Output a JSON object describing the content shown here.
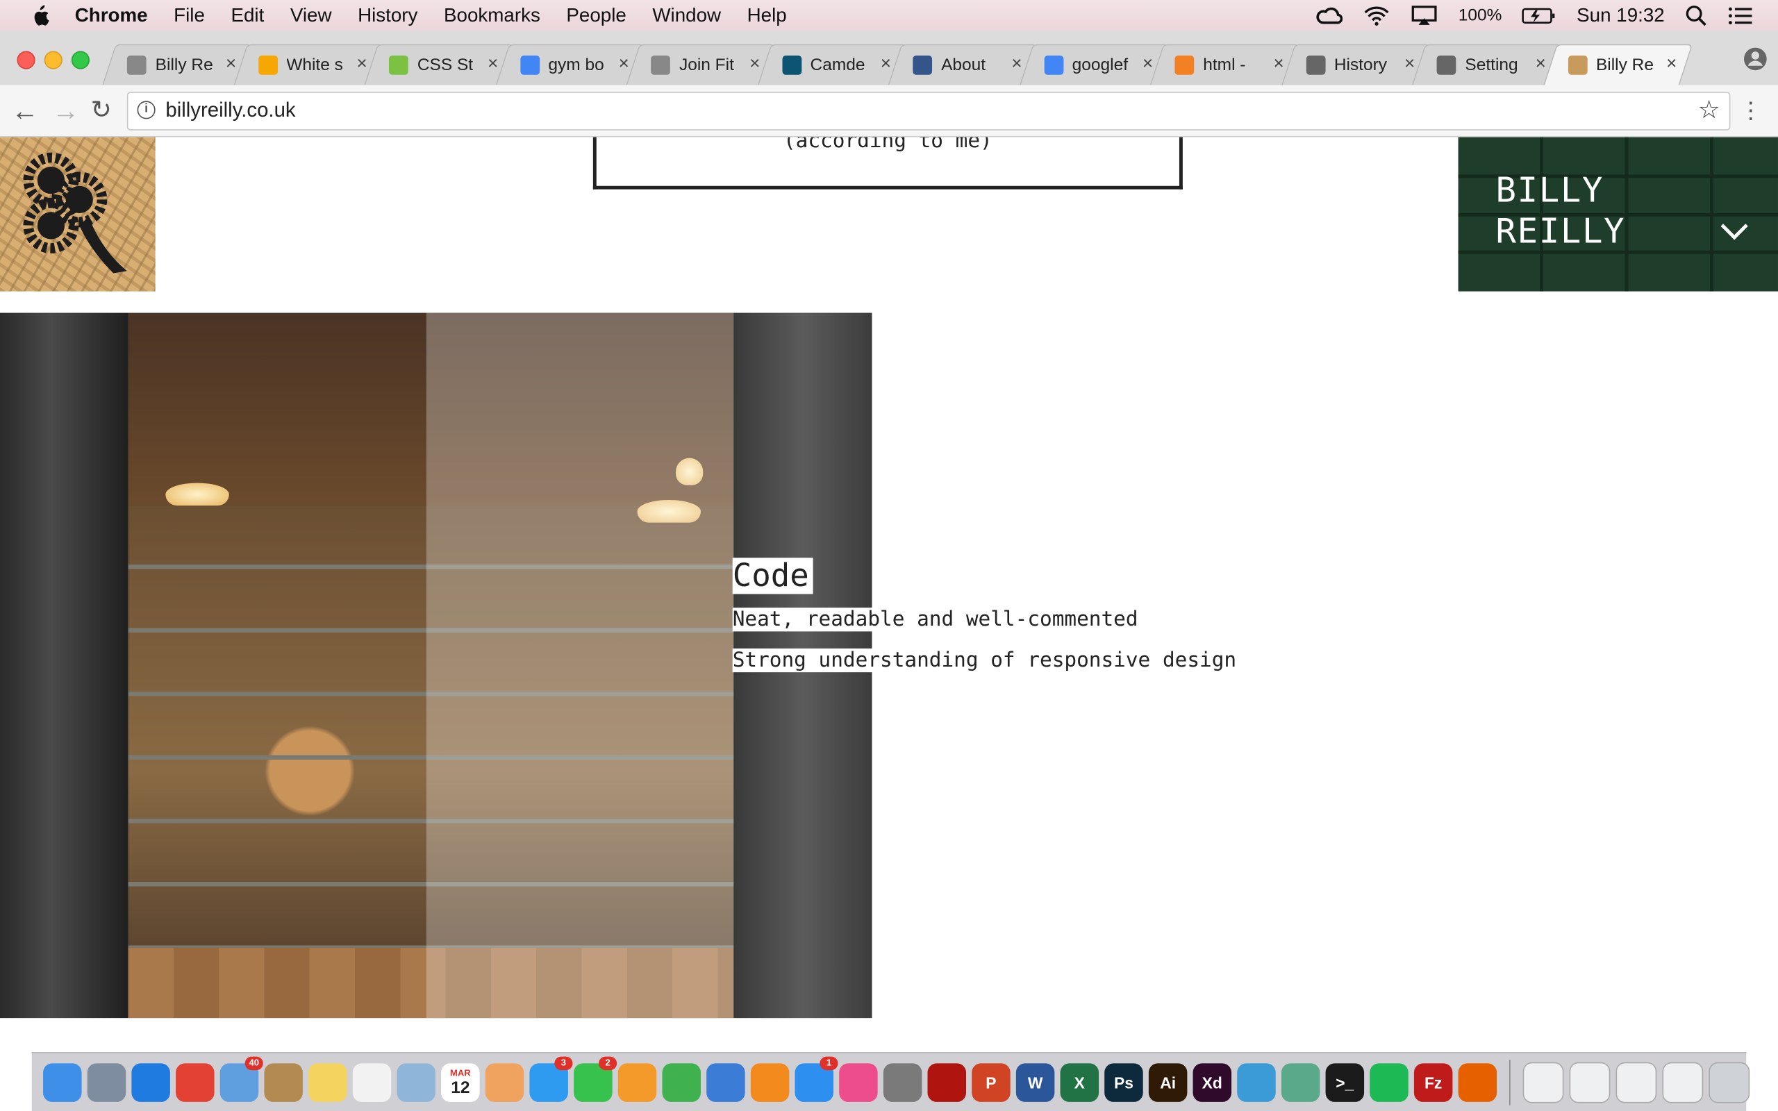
{
  "menubar": {
    "app": "Chrome",
    "items": [
      "File",
      "Edit",
      "View",
      "History",
      "Bookmarks",
      "People",
      "Window",
      "Help"
    ],
    "battery": "100%",
    "clock": "Sun 19:32"
  },
  "tabs": [
    {
      "title": "Billy Re",
      "icon": "document-icon",
      "color": "#888888"
    },
    {
      "title": "White s",
      "icon": "sketch-icon",
      "color": "#f7a800"
    },
    {
      "title": "CSS St",
      "icon": "css-icon",
      "color": "#7cc242"
    },
    {
      "title": "gym bo",
      "icon": "google-icon",
      "color": "#4285f4"
    },
    {
      "title": "Join Fit",
      "icon": "document-icon",
      "color": "#888888"
    },
    {
      "title": "Camde",
      "icon": "camden-icon",
      "color": "#0b5572"
    },
    {
      "title": "About",
      "icon": "pbs-icon",
      "color": "#33558a"
    },
    {
      "title": "googlef",
      "icon": "google-icon",
      "color": "#4285f4"
    },
    {
      "title": "html - ",
      "icon": "stackoverflow-icon",
      "color": "#f48024"
    },
    {
      "title": "History",
      "icon": "history-icon",
      "color": "#666666"
    },
    {
      "title": "Setting",
      "icon": "gear-icon",
      "color": "#666666"
    },
    {
      "title": "Billy Re",
      "icon": "site-logo-icon",
      "color": "#c89a5c",
      "active": true
    }
  ],
  "toolbar": {
    "url": "billyreilly.co.uk"
  },
  "page": {
    "tagline": "(according to me)",
    "brand_line1": "BILLY",
    "brand_line2": "REILLY",
    "feature_title": "Code",
    "feature_items": [
      "Neat, readable and well-commented",
      "Strong understanding of responsive design"
    ]
  },
  "dock": {
    "badges": {
      "mail": "40",
      "messages": "3",
      "facetime": "2",
      "appstore": "1"
    },
    "calendar_month": "MAR",
    "calendar_day": "12",
    "icons": [
      {
        "name": "finder-icon",
        "color": "#3d8fe8",
        "label": ""
      },
      {
        "name": "launchpad-icon",
        "color": "#7f8da0",
        "label": ""
      },
      {
        "name": "safari-icon",
        "color": "#1f7be0",
        "label": ""
      },
      {
        "name": "chrome-icon",
        "color": "#e34133",
        "label": ""
      },
      {
        "name": "mail-icon",
        "color": "#5f9fe0",
        "label": ""
      },
      {
        "name": "contacts-icon",
        "color": "#b38a52",
        "label": ""
      },
      {
        "name": "notes-icon",
        "color": "#f4d35e",
        "label": ""
      },
      {
        "name": "reminders-icon",
        "color": "#f2f2f2",
        "label": ""
      },
      {
        "name": "preview-icon",
        "color": "#8fb6d9",
        "label": ""
      },
      {
        "name": "calendar-icon",
        "color": "#ffffff",
        "label": ""
      },
      {
        "name": "photos-icon",
        "color": "#f0a35e",
        "label": ""
      },
      {
        "name": "messages-icon",
        "color": "#2f9bf0",
        "label": ""
      },
      {
        "name": "facetime-icon",
        "color": "#37c24e",
        "label": ""
      },
      {
        "name": "pages-icon",
        "color": "#f39a2b",
        "label": ""
      },
      {
        "name": "numbers-icon",
        "color": "#3fb24f",
        "label": ""
      },
      {
        "name": "keynote-icon",
        "color": "#3a7cd6",
        "label": ""
      },
      {
        "name": "ibooks-icon",
        "color": "#f28a1e",
        "label": ""
      },
      {
        "name": "appstore-icon",
        "color": "#2d8ff0",
        "label": ""
      },
      {
        "name": "itunes-icon",
        "color": "#ee4d8c",
        "label": ""
      },
      {
        "name": "system-preferences-icon",
        "color": "#7a7a7a",
        "label": ""
      },
      {
        "name": "acrobat-icon",
        "color": "#b0140f",
        "label": ""
      },
      {
        "name": "powerpoint-icon",
        "color": "#d04423",
        "label": "P"
      },
      {
        "name": "word-icon",
        "color": "#2b579a",
        "label": "W"
      },
      {
        "name": "excel-icon",
        "color": "#217346",
        "label": "X"
      },
      {
        "name": "photoshop-icon",
        "color": "#0d2a3d",
        "label": "Ps"
      },
      {
        "name": "illustrator-icon",
        "color": "#2f1a05",
        "label": "Ai"
      },
      {
        "name": "xd-icon",
        "color": "#2f0a2b",
        "label": "Xd"
      },
      {
        "name": "bridge-icon",
        "color": "#3a9bd6",
        "label": ""
      },
      {
        "name": "atom-icon",
        "color": "#5aa98a",
        "label": ""
      },
      {
        "name": "terminal-icon",
        "color": "#1b1b1b",
        "label": ">_"
      },
      {
        "name": "spotify-icon",
        "color": "#1db954",
        "label": ""
      },
      {
        "name": "filezilla-icon",
        "color": "#bf1b1b",
        "label": "Fz"
      },
      {
        "name": "firefox-icon",
        "color": "#e66000",
        "label": ""
      }
    ]
  }
}
